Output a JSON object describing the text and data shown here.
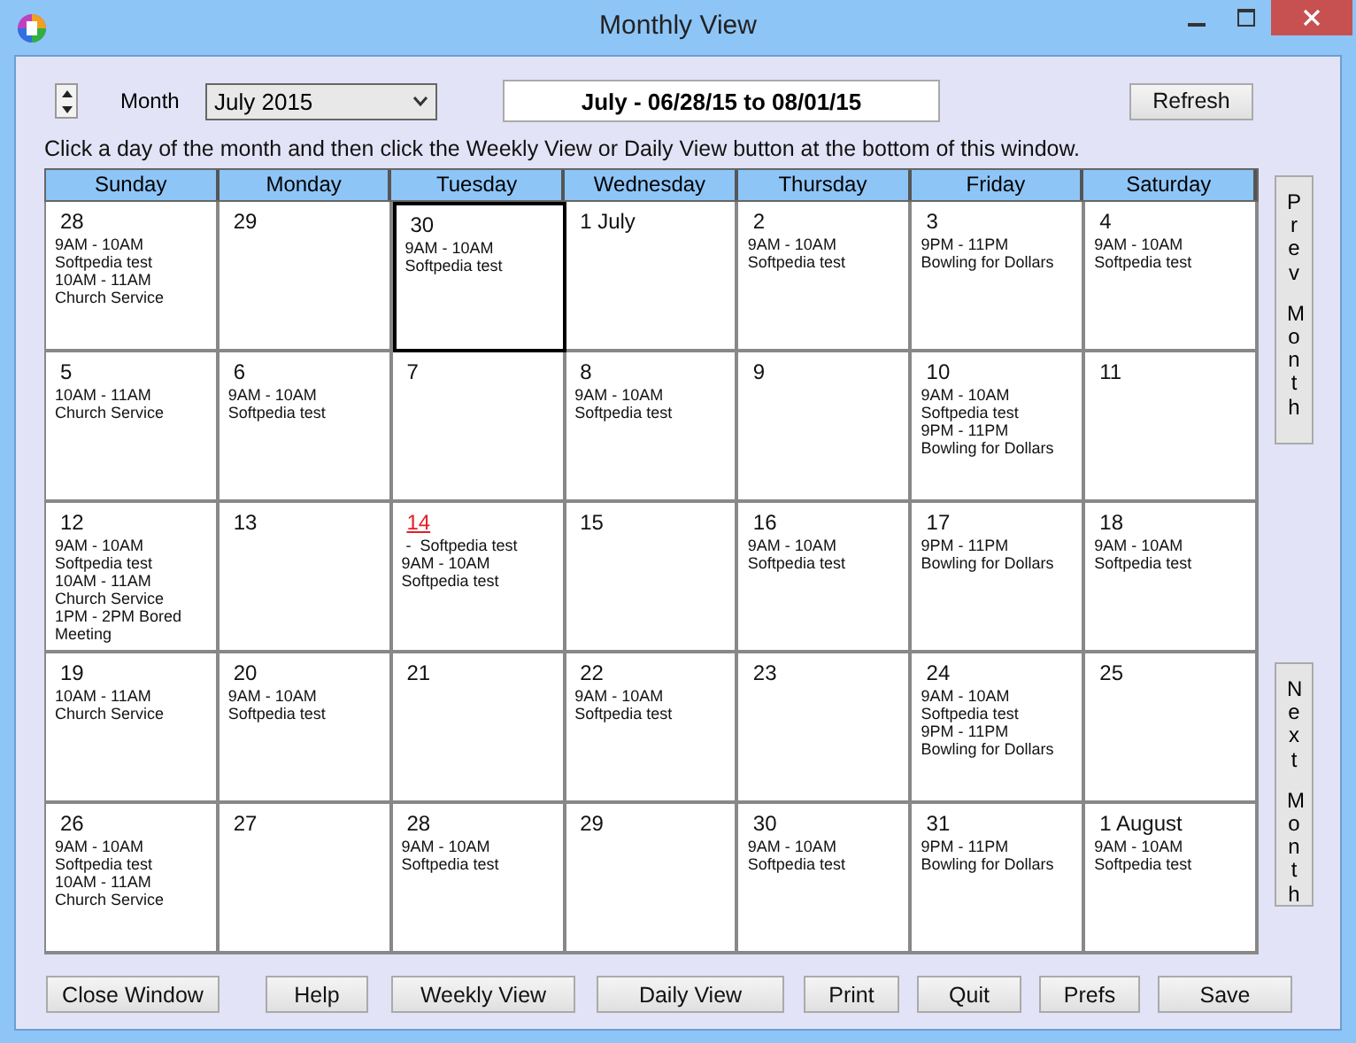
{
  "window": {
    "title": "Monthly View"
  },
  "toolbar": {
    "month_label": "Month",
    "month_select": "July 2015",
    "range": "July - 06/28/15 to 08/01/15",
    "refresh": "Refresh"
  },
  "instructions": "Click a day of the month and then click the Weekly View or Daily View button at the bottom of this window.",
  "weekdays": [
    "Sunday",
    "Monday",
    "Tuesday",
    "Wednesday",
    "Thursday",
    "Friday",
    "Saturday"
  ],
  "days": [
    {
      "label": "28",
      "selected": false,
      "today": false,
      "lines": [
        "9AM - 10AM",
        "Softpedia test",
        "10AM - 11AM",
        "Church Service"
      ]
    },
    {
      "label": "29",
      "selected": false,
      "today": false
    },
    {
      "label": "30",
      "selected": true,
      "today": false,
      "lines": [
        "9AM - 10AM",
        "Softpedia test"
      ]
    },
    {
      "label": "1 July",
      "selected": false,
      "today": false
    },
    {
      "label": "2",
      "selected": false,
      "today": false,
      "lines": [
        "9AM - 10AM",
        "Softpedia test"
      ]
    },
    {
      "label": "3",
      "selected": false,
      "today": false,
      "lines": [
        "9PM - 11PM",
        "Bowling for Dollars"
      ]
    },
    {
      "label": "4",
      "selected": false,
      "today": false,
      "lines": [
        "9AM - 10AM",
        "Softpedia test"
      ]
    },
    {
      "label": "5",
      "selected": false,
      "today": false,
      "lines": [
        "10AM - 11AM",
        "Church Service"
      ]
    },
    {
      "label": "6",
      "selected": false,
      "today": false,
      "lines": [
        "9AM - 10AM",
        "Softpedia test"
      ]
    },
    {
      "label": "7",
      "selected": false,
      "today": false
    },
    {
      "label": "8",
      "selected": false,
      "today": false,
      "lines": [
        "9AM - 10AM",
        "Softpedia test"
      ]
    },
    {
      "label": "9",
      "selected": false,
      "today": false
    },
    {
      "label": "10",
      "selected": false,
      "today": false,
      "lines": [
        "9AM - 10AM",
        "Softpedia test",
        "9PM - 11PM",
        "Bowling for Dollars"
      ]
    },
    {
      "label": "11",
      "selected": false,
      "today": false
    },
    {
      "label": "12",
      "selected": false,
      "today": false,
      "lines": [
        "9AM - 10AM",
        "Softpedia test",
        "10AM - 11AM",
        "Church Service",
        "1PM - 2PM Bored Meeting"
      ]
    },
    {
      "label": "13",
      "selected": false,
      "today": false
    },
    {
      "label": "14",
      "selected": false,
      "today": true,
      "lines": [
        " -  Softpedia test",
        "9AM - 10AM",
        "Softpedia test"
      ]
    },
    {
      "label": "15",
      "selected": false,
      "today": false
    },
    {
      "label": "16",
      "selected": false,
      "today": false,
      "lines": [
        "9AM - 10AM",
        "Softpedia test"
      ]
    },
    {
      "label": "17",
      "selected": false,
      "today": false,
      "lines": [
        "9PM - 11PM",
        "Bowling for Dollars"
      ]
    },
    {
      "label": "18",
      "selected": false,
      "today": false,
      "lines": [
        "9AM - 10AM",
        "Softpedia test"
      ]
    },
    {
      "label": "19",
      "selected": false,
      "today": false,
      "lines": [
        "10AM - 11AM",
        "Church Service"
      ]
    },
    {
      "label": "20",
      "selected": false,
      "today": false,
      "lines": [
        "9AM - 10AM",
        "Softpedia test"
      ]
    },
    {
      "label": "21",
      "selected": false,
      "today": false
    },
    {
      "label": "22",
      "selected": false,
      "today": false,
      "lines": [
        "9AM - 10AM",
        "Softpedia test"
      ]
    },
    {
      "label": "23",
      "selected": false,
      "today": false
    },
    {
      "label": "24",
      "selected": false,
      "today": false,
      "lines": [
        "9AM - 10AM",
        "Softpedia test",
        "9PM - 11PM",
        "Bowling for Dollars"
      ]
    },
    {
      "label": "25",
      "selected": false,
      "today": false
    },
    {
      "label": "26",
      "selected": false,
      "today": false,
      "lines": [
        "9AM - 10AM",
        "Softpedia test",
        "10AM - 11AM",
        "Church Service"
      ]
    },
    {
      "label": "27",
      "selected": false,
      "today": false
    },
    {
      "label": "28",
      "selected": false,
      "today": false,
      "lines": [
        "9AM - 10AM",
        "Softpedia test"
      ]
    },
    {
      "label": "29",
      "selected": false,
      "today": false
    },
    {
      "label": "30",
      "selected": false,
      "today": false,
      "lines": [
        "9AM - 10AM",
        "Softpedia test"
      ]
    },
    {
      "label": "31",
      "selected": false,
      "today": false,
      "lines": [
        "9PM - 11PM",
        "Bowling for Dollars"
      ]
    },
    {
      "label": "1 August",
      "selected": false,
      "today": false,
      "lines": [
        "9AM - 10AM",
        "Softpedia test"
      ]
    }
  ],
  "side_buttons": [
    "Prev Month",
    "Next Month"
  ],
  "buttons": [
    "Close Window",
    "Help",
    "Weekly View",
    "Daily View",
    "Print",
    "Quit",
    "Prefs",
    "Save"
  ]
}
